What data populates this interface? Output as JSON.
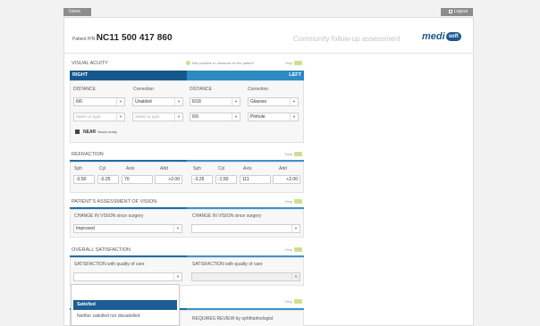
{
  "topbar": {
    "left_button": "Users",
    "right_button": "Logout"
  },
  "header": {
    "patient_label": "Patient P/N",
    "patient_number": "NC11 500 417 860",
    "assessment_title": "Community follow-up assessment",
    "logo_text": "medi",
    "logo_badge": "soft"
  },
  "help_label": "Help",
  "visual_acuity": {
    "title": "VISUAL ACUITY",
    "not_possible": "Not possible to measure for the patient",
    "right_label": "RIGHT",
    "left_label": "LEFT",
    "distance_label": "DISTANCE",
    "correction_label": "Correction",
    "right_distance": "6/6",
    "right_correction": "Unaided",
    "right_distance2": "Select or type",
    "right_correction2": "Select or type",
    "left_distance": "6/18",
    "left_correction": "Glasses",
    "left_distance2": "6/9",
    "left_correction2": "Pinhole",
    "near_label": "NEAR",
    "near_suffix": "Visual acuity"
  },
  "refraction": {
    "title": "REFRACTION",
    "headers": [
      "Sph",
      "Cyl",
      "Axis",
      "Add"
    ],
    "right": [
      "-0.50",
      "-0.25",
      "70",
      "+2.00"
    ],
    "left": [
      "-3.25",
      "-1.50",
      "111",
      "+2.00"
    ]
  },
  "assessment": {
    "title": "PATIENT'S ASSESSMENT OF VISION",
    "change_label": "CHANGE IN VISION",
    "change_suffix": "since surgery",
    "right_value": "Improved",
    "left_value": ""
  },
  "satisfaction": {
    "title": "OVERALL SATISFACTION",
    "sat_label": "SATISFACTION",
    "sat_suffix": "with quality of care",
    "right_value": "",
    "left_value": ""
  },
  "review": {
    "title_initial": "P",
    "requires_label": "REQUIRES REVIEW",
    "requires_suffix": "by ophthalmologist"
  },
  "dropdown": {
    "options": [
      "Satisfied",
      "Neither satisfied nor dissatisfied"
    ]
  },
  "colors": {
    "band_right": "#16588e",
    "band_left": "#2d8bc2",
    "help_icon": "#cde08d"
  }
}
